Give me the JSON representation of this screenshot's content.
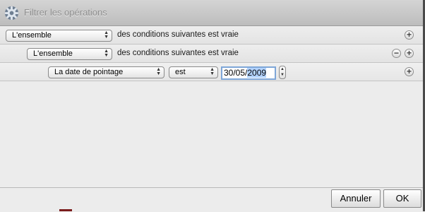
{
  "window": {
    "title": "Filtrer les opérations"
  },
  "rules": {
    "row1": {
      "scope": "L'ensemble",
      "text": "des conditions suivantes est vraie",
      "add": "+"
    },
    "row2": {
      "scope": "L'ensemble",
      "text": "des conditions suivantes est vraie",
      "remove": "−",
      "add": "+"
    },
    "row3": {
      "field": "La date de pointage",
      "operator": "est",
      "date_prefix": "30/05/",
      "date_selected": "2009",
      "add": "+"
    }
  },
  "buttons": {
    "cancel": "Annuler",
    "ok": "OK"
  },
  "icons": {
    "gear": "gear-icon",
    "popup_arrows": "up-down-arrows-icon",
    "stepper": "stepper-icon"
  },
  "colors": {
    "selection": "#b3d3ff",
    "focus_ring": "#7ea6d8"
  }
}
